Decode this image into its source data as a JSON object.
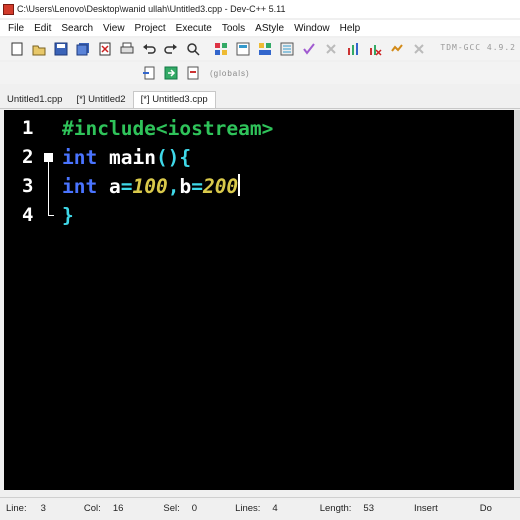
{
  "window": {
    "title": "C:\\Users\\Lenovo\\Desktop\\wanid ullah\\Untitled3.cpp - Dev-C++ 5.11"
  },
  "menu": [
    "File",
    "Edit",
    "Search",
    "View",
    "Project",
    "Execute",
    "Tools",
    "AStyle",
    "Window",
    "Help"
  ],
  "toolbar": {
    "compiler": "TDM-GCC 4.9.2",
    "globals": "(globals)"
  },
  "tabs": [
    {
      "label": "Untitled1.cpp",
      "active": false
    },
    {
      "label": "[*] Untitled2",
      "active": false
    },
    {
      "label": "[*] Untitled3.cpp",
      "active": true
    }
  ],
  "editor": {
    "line_numbers": [
      "1",
      "2",
      "3",
      "4"
    ],
    "lines": [
      [
        {
          "t": "#include<iostream>",
          "c": "pp"
        }
      ],
      [
        {
          "t": "int",
          "c": "kw"
        },
        {
          "t": " main",
          "c": "id"
        },
        {
          "t": "(){",
          "c": "sym"
        }
      ],
      [
        {
          "t": "int",
          "c": "kw"
        },
        {
          "t": " a",
          "c": "id"
        },
        {
          "t": "=",
          "c": "sym"
        },
        {
          "t": "100",
          "c": "num"
        },
        {
          "t": ",",
          "c": "sym"
        },
        {
          "t": "b",
          "c": "id"
        },
        {
          "t": "=",
          "c": "sym"
        },
        {
          "t": "200",
          "c": "num"
        }
      ],
      [
        {
          "t": "}",
          "c": "sym"
        }
      ]
    ]
  },
  "status": {
    "line_label": "Line:",
    "line": "3",
    "col_label": "Col:",
    "col": "16",
    "sel_label": "Sel:",
    "sel": "0",
    "lines_label": "Lines:",
    "lines": "4",
    "length_label": "Length:",
    "length": "53",
    "mode": "Insert",
    "extra": "Do"
  }
}
